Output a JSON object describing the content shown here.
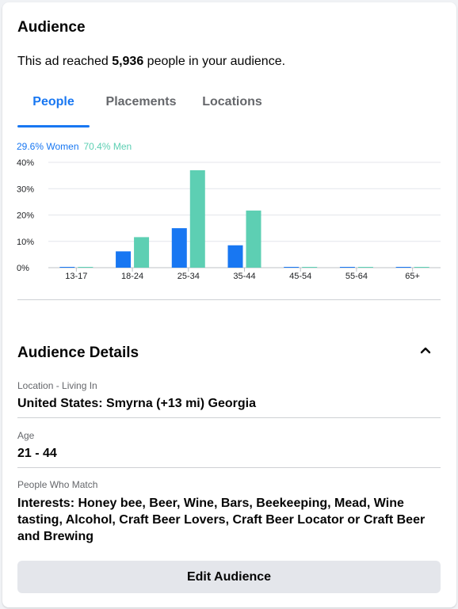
{
  "card": {
    "title": "Audience",
    "reach_prefix": "This ad reached ",
    "reach_count": "5,936",
    "reach_suffix": " people in your audience."
  },
  "tabs": [
    {
      "label": "People",
      "active": true
    },
    {
      "label": "Placements",
      "active": false
    },
    {
      "label": "Locations",
      "active": false
    }
  ],
  "gender": {
    "women_label": "29.6% Women",
    "men_label": "70.4% Men"
  },
  "colors": {
    "accent": "#1877f2",
    "women": "#1877f2",
    "men": "#5dcfb3",
    "muted_text": "#65676b",
    "button_bg": "#e4e6eb"
  },
  "chart_data": {
    "type": "bar",
    "categories": [
      "13-17",
      "18-24",
      "25-34",
      "35-44",
      "45-54",
      "55-64",
      "65+"
    ],
    "series": [
      {
        "name": "Women",
        "values": [
          0.3,
          6.2,
          15.0,
          8.5,
          0.3,
          0.3,
          0.3
        ]
      },
      {
        "name": "Men",
        "values": [
          0.3,
          11.6,
          37.0,
          21.7,
          0.3,
          0.3,
          0.3
        ]
      }
    ],
    "yticks": [
      "0%",
      "10%",
      "20%",
      "30%",
      "40%"
    ],
    "ylim": [
      0,
      40
    ],
    "grid": true
  },
  "details": {
    "title": "Audience Details",
    "collapse_icon": "chevron-up-icon",
    "location_label": "Location - Living In",
    "location_value": "United States: Smyrna (+13 mi) Georgia",
    "age_label": "Age",
    "age_value": "21 - 44",
    "match_label": "People Who Match",
    "match_value": "Interests: Honey bee, Beer, Wine, Bars, Beekeeping, Mead, Wine tasting, Alcohol, Craft Beer Lovers, Craft Beer Locator or Craft Beer and Brewing"
  },
  "actions": {
    "edit_label": "Edit Audience"
  }
}
